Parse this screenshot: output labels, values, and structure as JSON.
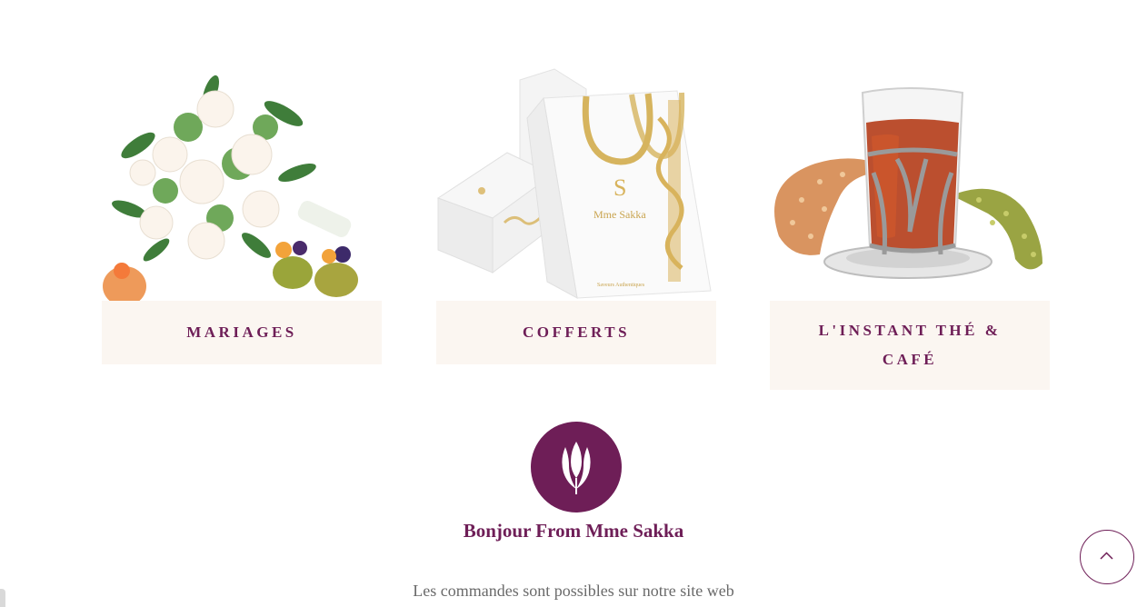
{
  "cards": [
    {
      "label": "Mariages",
      "image": "wedding-bouquet-with-pastries"
    },
    {
      "label": "Cofferts",
      "image": "mme-sakka-gift-bag-and-boxes"
    },
    {
      "label": "L'Instant Thé & Café",
      "image": "tea-glass-with-crescent-pastries"
    }
  ],
  "logo": {
    "icon": "tulip-icon",
    "color": "#6e1e57"
  },
  "greeting": "Bonjour From Mme Sakka",
  "subtext": "Les commandes sont possibles sur notre site web",
  "scroll_top": {
    "icon": "chevron-up-icon"
  },
  "colors": {
    "accent": "#6e1e57",
    "card_bg": "#fbf6f1",
    "text_muted": "#6a6a6a"
  }
}
